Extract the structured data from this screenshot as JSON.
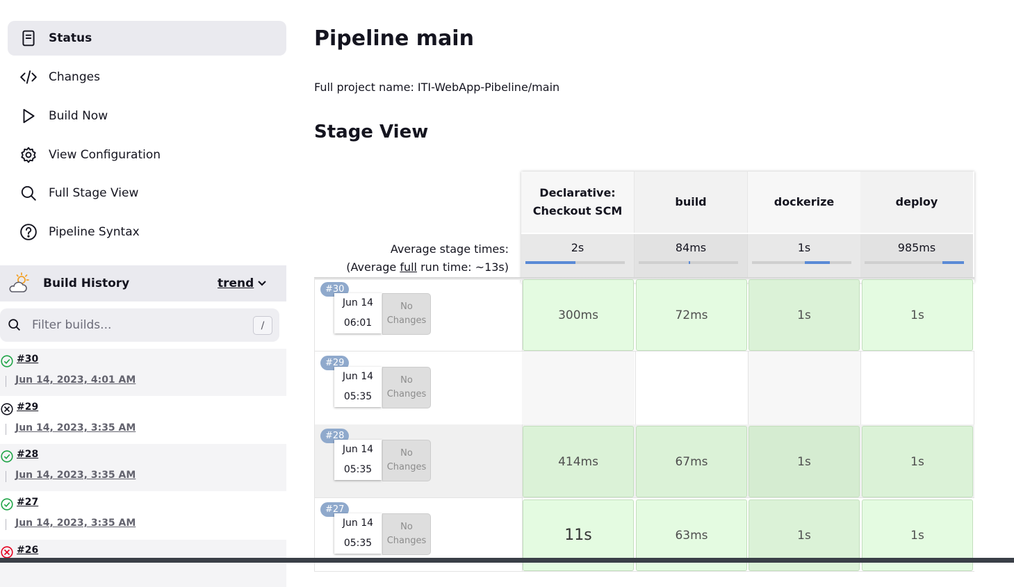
{
  "sidebar": {
    "items": [
      {
        "label": "Status",
        "icon": "status-document-icon",
        "active": true
      },
      {
        "label": "Changes",
        "icon": "code-icon"
      },
      {
        "label": "Build Now",
        "icon": "play-icon"
      },
      {
        "label": "View Configuration",
        "icon": "gear-icon"
      },
      {
        "label": "Full Stage View",
        "icon": "search-icon"
      },
      {
        "label": "Pipeline Syntax",
        "icon": "help-icon"
      }
    ]
  },
  "build_history": {
    "title": "Build History",
    "trend_label": "trend",
    "filter_placeholder": "Filter builds...",
    "shortcut": "/",
    "builds": [
      {
        "number": "#30",
        "date": "Jun 14, 2023, 4:01 AM",
        "status": "success"
      },
      {
        "number": "#29",
        "date": "Jun 14, 2023, 3:35 AM",
        "status": "aborted"
      },
      {
        "number": "#28",
        "date": "Jun 14, 2023, 3:35 AM",
        "status": "success"
      },
      {
        "number": "#27",
        "date": "Jun 14, 2023, 3:35 AM",
        "status": "success"
      },
      {
        "number": "#26",
        "date": "",
        "status": "failed"
      }
    ]
  },
  "main": {
    "title": "Pipeline main",
    "full_name": "Full project name: ITI-WebApp-Pibeline/main",
    "stage_view_title": "Stage View"
  },
  "stage_view": {
    "avg_label_line1": "Average stage times:",
    "avg_label_prefix": "(Average ",
    "avg_label_link": "full",
    "avg_label_suffix": " run time: ~13s)",
    "stages": [
      {
        "name_line1": "Declarative:",
        "name_line2": "Checkout SCM",
        "avg": "2s",
        "bar_fraction": 0.5
      },
      {
        "name_line1": "build",
        "name_line2": "",
        "avg": "84ms",
        "bar_fraction": 0.02
      },
      {
        "name_line1": "dockerize",
        "name_line2": "",
        "avg": "1s",
        "bar_fraction": 0.25
      },
      {
        "name_line1": "deploy",
        "name_line2": "",
        "avg": "985ms",
        "bar_fraction": 0.22
      }
    ],
    "runs": [
      {
        "badge": "#30",
        "date": "Jun 14",
        "time": "06:01",
        "changes_line1": "No",
        "changes_line2": "Changes",
        "durations": [
          "300ms",
          "72ms",
          "1s",
          "1s"
        ]
      },
      {
        "badge": "#29",
        "date": "Jun 14",
        "time": "05:35",
        "changes_line1": "No",
        "changes_line2": "Changes",
        "durations": []
      },
      {
        "badge": "#28",
        "date": "Jun 14",
        "time": "05:35",
        "changes_line1": "No",
        "changes_line2": "Changes",
        "durations": [
          "414ms",
          "67ms",
          "1s",
          "1s"
        ]
      },
      {
        "badge": "#27",
        "date": "Jun 14",
        "time": "05:35",
        "changes_line1": "No",
        "changes_line2": "Changes",
        "durations": [
          "11s",
          "63ms",
          "1s",
          "1s"
        ]
      }
    ]
  },
  "colors": {
    "success": "#1ea446",
    "failed": "#e6001f",
    "aborted": "#14141f",
    "stage_success": "#e4fbe1",
    "progress": "#5a8ad6",
    "badge": "#8fa9cc"
  }
}
